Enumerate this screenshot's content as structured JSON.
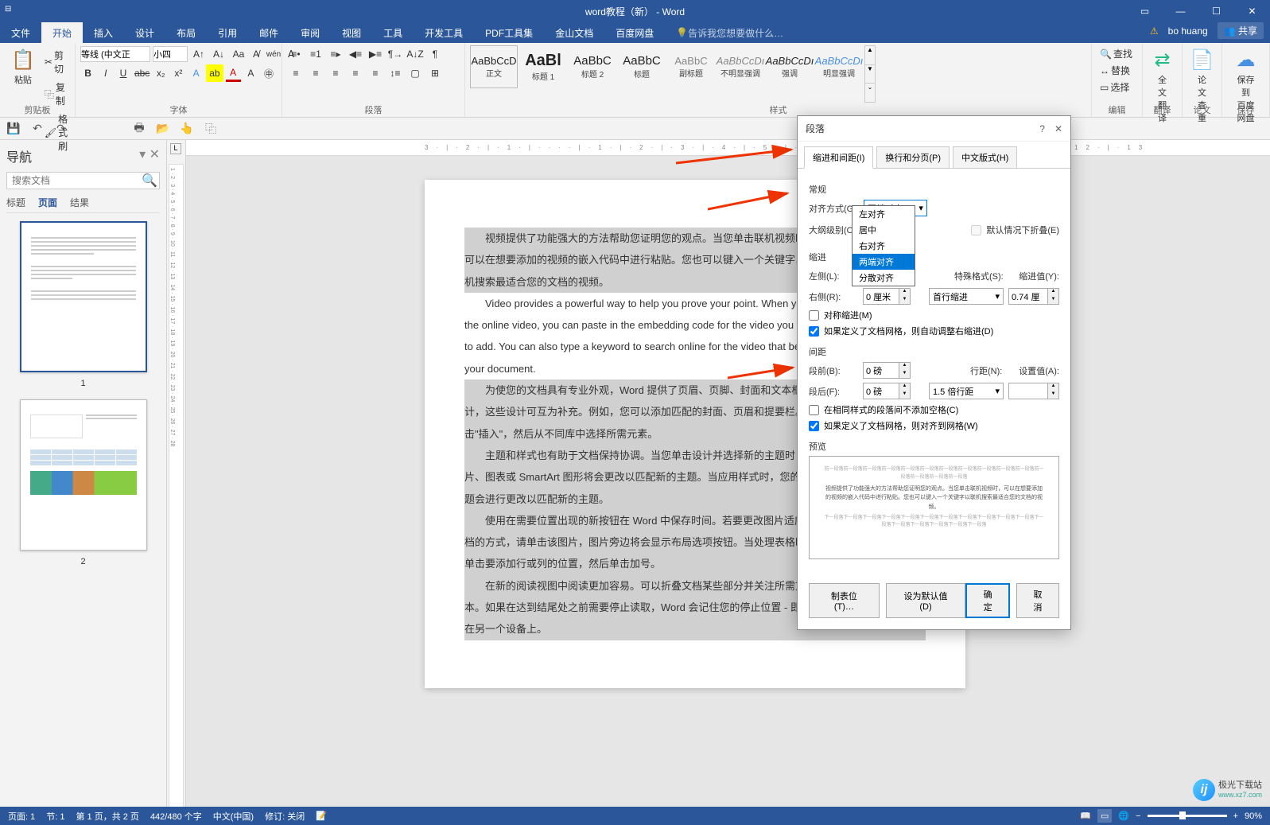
{
  "titlebar": {
    "title": "word教程（新） - Word"
  },
  "menubar": {
    "tabs": [
      "文件",
      "开始",
      "插入",
      "设计",
      "布局",
      "引用",
      "邮件",
      "审阅",
      "视图",
      "工具",
      "开发工具",
      "PDF工具集",
      "金山文档",
      "百度网盘"
    ],
    "active_index": 1,
    "tell_me": "告诉我您想要做什么…",
    "user": "bo huang",
    "share": "共享"
  },
  "ribbon": {
    "clipboard": {
      "paste": "粘贴",
      "cut": "剪切",
      "copy": "复制",
      "format_painter": "格式刷",
      "label": "剪贴板"
    },
    "font": {
      "family": "等线 (中文正",
      "size": "小四",
      "label": "字体"
    },
    "paragraph": {
      "label": "段落"
    },
    "styles": {
      "items": [
        {
          "preview": "AaBbCcD",
          "name": "正文"
        },
        {
          "preview": "AaBl",
          "name": "标题 1"
        },
        {
          "preview": "AaBbC",
          "name": "标题 2"
        },
        {
          "preview": "AaBbC",
          "name": "标题"
        },
        {
          "preview": "AaBbC",
          "name": "副标题"
        },
        {
          "preview": "AaBbCcDı",
          "name": "不明显强调"
        },
        {
          "preview": "AaBbCcDı",
          "name": "强调"
        },
        {
          "preview": "AaBbCcDı",
          "name": "明显强调"
        }
      ],
      "label": "样式"
    },
    "editing": {
      "find": "查找",
      "replace": "替换",
      "select": "选择",
      "label": "编辑"
    },
    "translate": {
      "full": "全文\n翻译",
      "label": "翻译"
    },
    "thesis": {
      "check": "论文\n查重",
      "label": "论文"
    },
    "save": {
      "cloud": "保存到\n百度网盘",
      "label": "保存"
    }
  },
  "nav": {
    "title": "导航",
    "search_placeholder": "搜索文档",
    "tabs": [
      "标题",
      "页面",
      "结果"
    ],
    "active_tab": 1,
    "page_nums": [
      "1",
      "2"
    ]
  },
  "document": {
    "paragraphs": [
      "视频提供了功能强大的方法帮助您证明您的观点。当您单击联机视频时，",
      "可以在想要添加的视频的嵌入代码中进行粘贴。您也可以键入一个关键字以联",
      "机搜索最适合您的文档的视频。",
      "Video provides a powerful way to help you prove your point. When you click",
      "the online video, you can paste in the embedding code for the video you want",
      "to add. You can also type a keyword to search online for the video that best fits",
      "your document.",
      "为使您的文档具有专业外观，Word 提供了页眉、页脚、封面和文本框设",
      "计，这些设计可互为补充。例如，您可以添加匹配的封面、页眉和提要栏。单",
      "击\"插入\"，然后从不同库中选择所需元素。",
      "主题和样式也有助于文档保持协调。当您单击设计并选择新的主题时，图",
      "片、图表或 SmartArt 图形将会更改以匹配新的主题。当应用样式时，您的标",
      "题会进行更改以匹配新的主题。",
      "使用在需要位置出现的新按钮在 Word 中保存时间。若要更改图片适应文",
      "档的方式，请单击该图片，图片旁边将会显示布局选项按钮。当处理表格时，",
      "单击要添加行或列的位置，然后单击加号。",
      "在新的阅读视图中阅读更加容易。可以折叠文档某些部分并关注所需文",
      "本。如果在达到结尾处之前需要停止读取，Word 会记住您的停止位置 - 即使",
      "在另一个设备上。"
    ]
  },
  "dialog": {
    "title": "段落",
    "tabs": [
      "缩进和间距(I)",
      "换行和分页(P)",
      "中文版式(H)"
    ],
    "general": "常规",
    "alignment_label": "对齐方式(G):",
    "alignment_value": "两端对齐",
    "alignment_options": [
      "左对齐",
      "居中",
      "右对齐",
      "两端对齐",
      "分散对齐"
    ],
    "outline_label": "大纲级别(O):",
    "collapse_label": "默认情况下折叠(E)",
    "indent_section": "缩进",
    "left_label": "左侧(L):",
    "left_value": "0 厘米",
    "right_label": "右侧(R):",
    "right_value": "0 厘米",
    "special_label": "特殊格式(S):",
    "special_value": "首行缩进",
    "by_label": "缩进值(Y):",
    "by_value": "0.74 厘",
    "mirror_label": "对称缩进(M)",
    "auto_right_label": "如果定义了文档网格，则自动调整右缩进(D)",
    "spacing_section": "间距",
    "before_label": "段前(B):",
    "before_value": "0 磅",
    "after_label": "段后(F):",
    "after_value": "0 磅",
    "line_label": "行距(N):",
    "line_value": "1.5 倍行距",
    "at_label": "设置值(A):",
    "no_space_label": "在相同样式的段落间不添加空格(C)",
    "snap_grid_label": "如果定义了文档网格，则对齐到网格(W)",
    "preview_label": "预览",
    "preview_light1": "前一段落前一段落前一段落前一段落前一段落前一段落前一段落前一段落前一段落前一段落前一段落前一段落前一段落前一段落前一段落",
    "preview_dark": "视频提供了功能强大的方法帮助您证明您的观点。当您单击联机视频时，可以在想要添加的视频的嵌入代码中进行粘贴。您也可以键入一个关键字以联机搜索最适合您的文档的视频。",
    "preview_light2": "下一段落下一段落下一段落下一段落下一段落下一段落下一段落下一段落下一段落下一段落下一段落下一段落下一段落下一段落下一段落下一段落下一段落",
    "tabs_btn": "制表位(T)…",
    "default_btn": "设为默认值(D)",
    "ok_btn": "确定",
    "cancel_btn": "取消"
  },
  "statusbar": {
    "page": "页面: 1",
    "section": "节: 1",
    "page_of": "第 1 页，共 2 页",
    "words": "442/480 个字",
    "lang": "中文(中国)",
    "track": "修订: 关闭",
    "zoom": "90%"
  },
  "watermark": {
    "brand": "极光下载站",
    "url": "www.xz7.com"
  },
  "ruler_h": "3·|·2·|·1·|····|·1·|·2·|·3·|·4·|·5·|·6·|·7·|·8·|·9·|·10·|·11·|·12·|·13"
}
